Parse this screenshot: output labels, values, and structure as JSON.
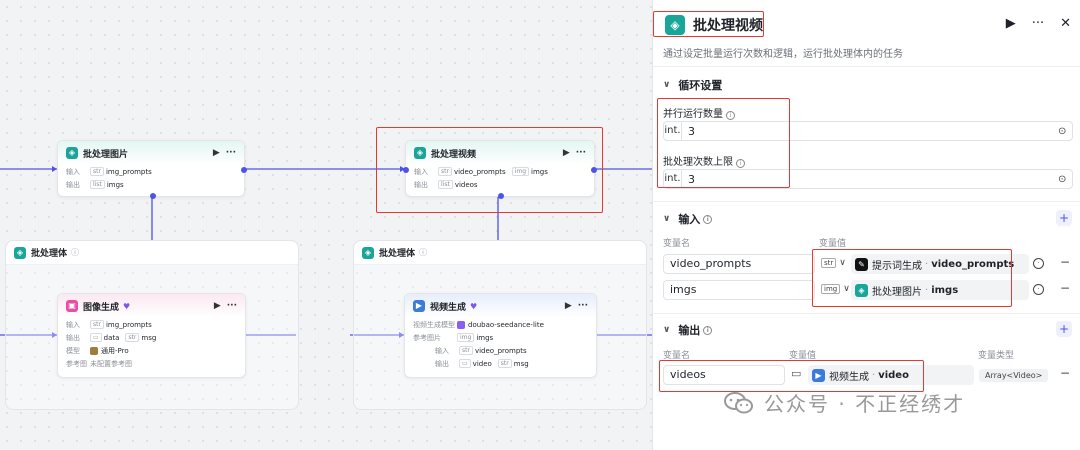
{
  "canvas": {
    "batch_images_node": {
      "title": "批处理图片",
      "input_label": "输入",
      "input_tag": "str",
      "input_value": "img_prompts",
      "output_label": "输出",
      "output_tag": "list",
      "output_value": "imgs"
    },
    "batch_video_node": {
      "title": "批处理视频",
      "input_label": "输入",
      "input_tag1": "str",
      "input_value1": "video_prompts",
      "input_tag2": "img",
      "input_value2": "imgs",
      "output_label": "输出",
      "output_tag": "list",
      "output_value": "videos"
    },
    "batch_body_left": {
      "title": "批处理体"
    },
    "batch_body_right": {
      "title": "批处理体"
    },
    "image_gen_node": {
      "title": "图像生成",
      "input_label": "输入",
      "input_tag": "str",
      "input_value": "img_prompts",
      "output_label": "输出",
      "output_value1": "data",
      "output_tag2": "str",
      "output_value2": "msg",
      "model_label": "模型",
      "model_value": "通用-Pro",
      "ref_label": "参考图",
      "ref_value": "未配置参考图"
    },
    "video_gen_node": {
      "title": "视频生成",
      "model_label": "视频生成模型",
      "model_value": "doubao-seedance-lite",
      "ref_label": "参考图片",
      "ref_tag": "img",
      "ref_value": "imgs",
      "input_label": "输入",
      "input_tag": "str",
      "input_value": "video_prompts",
      "output_label": "输出",
      "output_value1": "video",
      "output_tag2": "str",
      "output_value2": "msg"
    }
  },
  "panel": {
    "title": "批处理视频",
    "description": "通过设定批量运行次数和逻辑，运行批处理体内的任务",
    "loop_section": {
      "title": "循环设置",
      "parallel_label": "并行运行数量",
      "parallel_type": "int.",
      "parallel_value": "3",
      "max_label": "批处理次数上限",
      "max_type": "int.",
      "max_value": "3"
    },
    "input_section": {
      "title": "输入",
      "col_name": "变量名",
      "col_value": "变量值",
      "rows": [
        {
          "name": "video_prompts",
          "type": "str",
          "source": "提示词生成",
          "field": "video_prompts"
        },
        {
          "name": "imgs",
          "type": "img",
          "source": "批处理图片",
          "field": "imgs"
        }
      ]
    },
    "output_section": {
      "title": "输出",
      "col_name": "变量名",
      "col_value": "变量值",
      "col_type": "变量类型",
      "rows": [
        {
          "name": "videos",
          "source": "视频生成",
          "field": "video",
          "type": "Array<Video>"
        }
      ]
    }
  },
  "watermark": {
    "text": "公众号 · 不正经绣才"
  },
  "colors": {
    "accent": "#4d53e8",
    "teal": "#1aa59a",
    "highlight": "#e53935"
  }
}
